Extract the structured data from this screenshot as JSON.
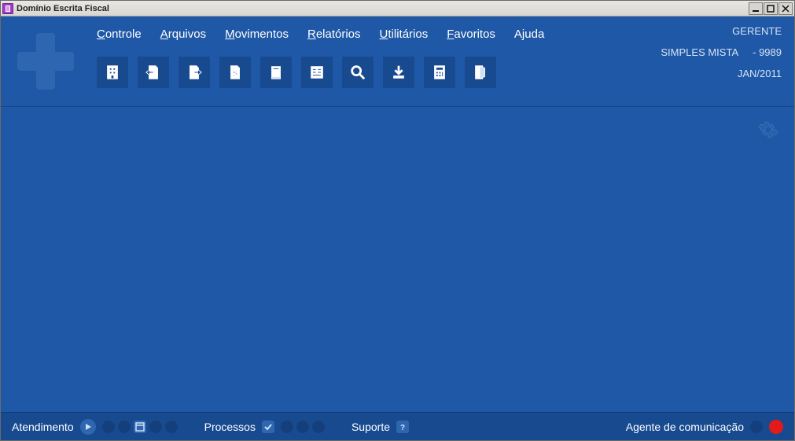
{
  "window": {
    "title": "Domínio Escrita Fiscal"
  },
  "menu": {
    "controle": "Controle",
    "arquivos": "Arquivos",
    "movimentos": "Movimentos",
    "relatorios": "Relatórios",
    "utilitarios": "Utilitários",
    "favoritos": "Favoritos",
    "ajuda": "Ajuda"
  },
  "header": {
    "user": "GERENTE",
    "company": "SIMPLES MISTA",
    "company_code": "- 9989",
    "period": "JAN/2011"
  },
  "toolbar": {
    "items": [
      "building-icon",
      "doc-in-icon",
      "doc-out-icon",
      "doc-money-icon",
      "book-icon",
      "form-icon",
      "search-icon",
      "download-icon",
      "calculator-icon",
      "exit-icon"
    ]
  },
  "statusbar": {
    "atendimento": "Atendimento",
    "processos": "Processos",
    "suporte": "Suporte",
    "agente": "Agente de comunicação"
  }
}
